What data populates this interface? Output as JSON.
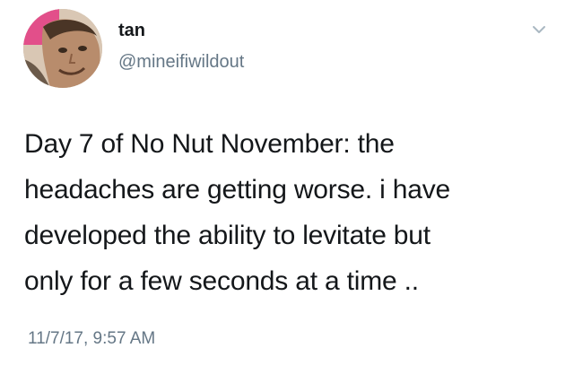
{
  "tweet": {
    "display_name": "tan",
    "handle": "@mineifiwildout",
    "avatar_icon": "user-avatar",
    "menu_icon": "chevron-down-icon",
    "text": "Day 7 of No Nut November: the\nheadaches are getting worse. i have\ndeveloped the ability to levitate but\nonly for a few seconds at a time ..",
    "timestamp": "11/7/17, 9:57 AM"
  },
  "colors": {
    "text": "#14171a",
    "secondary": "#657786",
    "background": "#ffffff"
  }
}
